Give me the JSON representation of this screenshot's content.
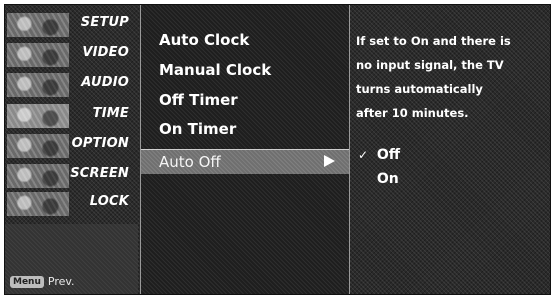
{
  "sidebar": {
    "items": [
      {
        "label": "SETUP"
      },
      {
        "label": "VIDEO"
      },
      {
        "label": "AUDIO"
      },
      {
        "label": "TIME"
      },
      {
        "label": "OPTION"
      },
      {
        "label": "SCREEN"
      },
      {
        "label": "LOCK"
      }
    ],
    "hint": {
      "key_label": "Menu",
      "text": "Prev."
    }
  },
  "submenu": {
    "items": [
      {
        "label": "Auto Clock"
      },
      {
        "label": "Manual Clock"
      },
      {
        "label": "Off Timer"
      },
      {
        "label": "On Timer"
      },
      {
        "label": "Auto Off"
      }
    ],
    "selected_index": 4
  },
  "help": {
    "lines": [
      "If set to On and there is",
      "no input signal, the TV",
      "turns automatically",
      "after 10 minutes."
    ]
  },
  "options": {
    "items": [
      {
        "label": "Off",
        "checked": true,
        "check_mark": "✓"
      },
      {
        "label": "On",
        "checked": false
      }
    ]
  },
  "colors": {
    "text": "#ffffff",
    "selected_row": "#6f6f6f"
  }
}
